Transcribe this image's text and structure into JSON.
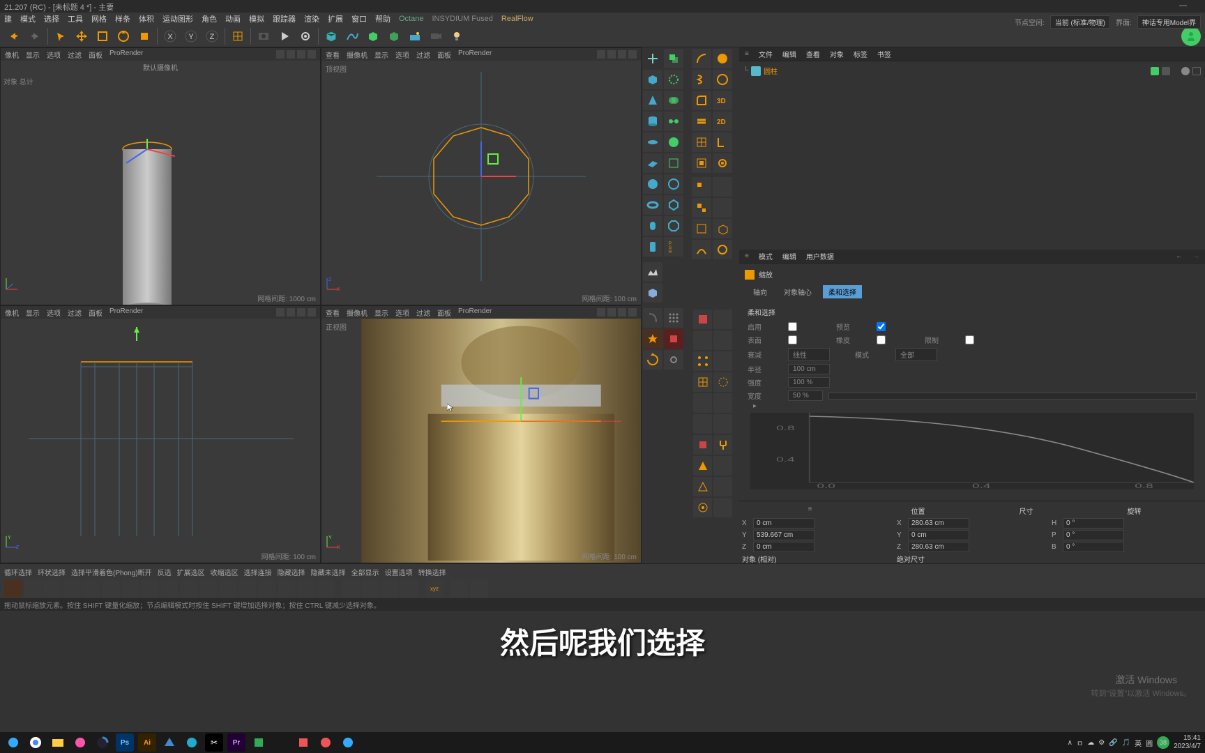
{
  "title_bar": {
    "title": "21.207 (RC) - [未标题 4 *] - 主要",
    "minimize": "—"
  },
  "menu": {
    "items": [
      "建",
      "模式",
      "选择",
      "工具",
      "网格",
      "样条",
      "体积",
      "运动图形",
      "角色",
      "动画",
      "模拟",
      "跟踪器",
      "渲染",
      "扩展",
      "窗口",
      "帮助"
    ],
    "plugins": [
      "Octane",
      "INSYDIUM Fused",
      "RealFlow"
    ]
  },
  "top_right": {
    "node_space_label": "节点空间:",
    "node_space_value": "当前 (标准/物理)",
    "interface_label": "界面:",
    "interface_value": "神话专用Model界"
  },
  "viewports": {
    "menu": [
      "查看",
      "摄像机",
      "显示",
      "选项",
      "过滤",
      "面板",
      "ProRender"
    ],
    "menu_short": [
      "像机",
      "显示",
      "选项",
      "过滤",
      "面板",
      "ProRender"
    ],
    "persp": {
      "camera": "默认摄像机",
      "grid": "网格间距: 1000 cm",
      "axis_label": "对象 总计"
    },
    "top": {
      "label": "顶视图",
      "grid": "网格间距: 100 cm"
    },
    "right": {
      "grid": "网格间距: 100 cm"
    },
    "front": {
      "label": "正视图",
      "grid": "网格间距: 100 cm"
    }
  },
  "object_panel": {
    "menu": [
      "文件",
      "编辑",
      "查看",
      "对象",
      "标签",
      "书签"
    ],
    "item": {
      "name": "圆柱"
    }
  },
  "attr_panel": {
    "menu": [
      "模式",
      "编辑",
      "用户数据"
    ],
    "title": "缩放",
    "tabs": [
      "轴向",
      "对象轴心",
      "柔和选择"
    ],
    "active_tab": 2,
    "section_title": "柔和选择",
    "enable_label": "启用",
    "preview_label": "预览",
    "surface_label": "表面",
    "ratio_label": "橡皮",
    "limit_label": "限制",
    "falloff_label": "衰减",
    "falloff_value": "线性",
    "mode_label": "模式",
    "mode_value": "全部",
    "radius_label": "半径",
    "radius_value": "100 cm",
    "strength_label": "强度",
    "strength_value": "100 %",
    "width_label": "宽度",
    "width_value": "50 %",
    "curve_ticks_y": [
      "0.8",
      "0.4"
    ],
    "curve_ticks_x": [
      "0.0",
      "0.4",
      "0.8"
    ]
  },
  "coords": {
    "headers": [
      "位置",
      "尺寸",
      "旋转"
    ],
    "x_label": "X",
    "y_label": "Y",
    "z_label": "Z",
    "pos": {
      "x": "0 cm",
      "y": "539.667 cm",
      "z": "0 cm"
    },
    "size": {
      "x": "280.63 cm",
      "y": "0 cm",
      "z": "280.63 cm"
    },
    "rot": {
      "h": "0 °",
      "p": "0 °",
      "b": "0 °"
    },
    "h_label": "H",
    "p_label": "P",
    "b_label": "B",
    "object_dd": "对象 (相对)",
    "size_dd": "绝对尺寸"
  },
  "bottom_tabs": [
    "循环选择",
    "环状选择",
    "选择平滑着色(Phong)断开",
    "反选",
    "扩展选区",
    "收缩选区",
    "选择连接",
    "隐藏选择",
    "隐藏未选择",
    "全部显示",
    "设置选项",
    "转换选择"
  ],
  "status_bar": "拖动鼠标缩放元素。按住 SHIFT 键量化缩放；节点编辑模式时按住 SHIFT 键增加选择对象；按住 CTRL 键减少选择对象。",
  "subtitle": "然后呢我们选择",
  "watermark": {
    "line1": "激活 Windows",
    "line2": "转到\"设置\"以激活 Windows。"
  },
  "taskbar": {
    "time": "15:41",
    "date": "2023/4/7",
    "tray_items": [
      "∧",
      "ㅁ",
      "☁",
      "⚙",
      "🔗",
      "🎵",
      "英",
      "圓"
    ],
    "temp": "38"
  }
}
